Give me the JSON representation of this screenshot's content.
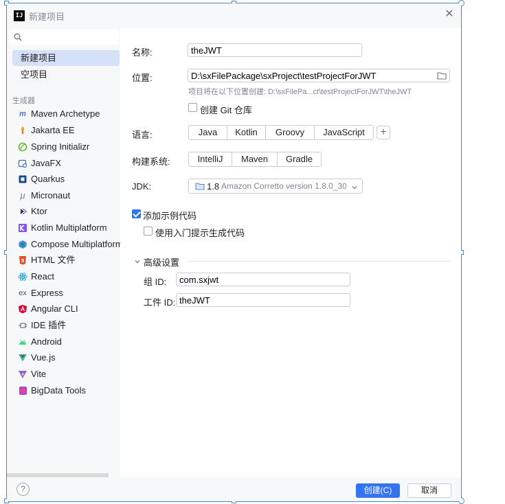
{
  "window": {
    "title": "新建项目",
    "close_icon": "close-icon"
  },
  "sidebar": {
    "search_placeholder": "",
    "top_items": [
      {
        "label": "新建项目",
        "selected": true
      },
      {
        "label": "空项目",
        "selected": false
      }
    ],
    "section_label": "生成器",
    "generators": [
      {
        "label": "Maven Archetype",
        "icon": "maven-icon"
      },
      {
        "label": "Jakarta EE",
        "icon": "jakarta-ee-icon"
      },
      {
        "label": "Spring Initializr",
        "icon": "spring-icon"
      },
      {
        "label": "JavaFX",
        "icon": "javafx-icon"
      },
      {
        "label": "Quarkus",
        "icon": "quarkus-icon"
      },
      {
        "label": "Micronaut",
        "icon": "micronaut-icon"
      },
      {
        "label": "Ktor",
        "icon": "ktor-icon"
      },
      {
        "label": "Kotlin Multiplatform",
        "icon": "kotlin-icon"
      },
      {
        "label": "Compose Multiplatform",
        "icon": "compose-icon"
      },
      {
        "label": "HTML 文件",
        "icon": "html5-icon"
      },
      {
        "label": "React",
        "icon": "react-icon"
      },
      {
        "label": "Express",
        "icon": "express-icon"
      },
      {
        "label": "Angular CLI",
        "icon": "angular-icon"
      },
      {
        "label": "IDE 插件",
        "icon": "plugin-icon"
      },
      {
        "label": "Android",
        "icon": "android-icon"
      },
      {
        "label": "Vue.js",
        "icon": "vue-icon"
      },
      {
        "label": "Vite",
        "icon": "vite-icon"
      },
      {
        "label": "BigData Tools",
        "icon": "bigdata-icon"
      }
    ]
  },
  "form": {
    "name_label": "名称:",
    "name_value": "theJWT",
    "location_label": "位置:",
    "location_value": "D:\\sxFilePackage\\sxProject\\testProjectForJWT",
    "location_hint": "项目将在以下位置创建: D:\\sxFilePa...ct\\testProjectForJWT\\theJWT",
    "git_label": "创建 Git 仓库",
    "git_checked": false,
    "language_label": "语言:",
    "languages": [
      "Java",
      "Kotlin",
      "Groovy",
      "JavaScript"
    ],
    "build_label": "构建系统:",
    "build_systems": [
      "IntelliJ",
      "Maven",
      "Gradle"
    ],
    "jdk_label": "JDK:",
    "jdk_version": "1.8",
    "jdk_name": "Amazon Corretto version 1.8.0_30",
    "sample_label": "添加示例代码",
    "sample_checked": true,
    "onboarding_label": "使用入门提示生成代码",
    "onboarding_checked": false,
    "advanced_label": "高级设置",
    "group_label": "组 ID:",
    "group_value": "com.sxjwt",
    "artifact_label": "工件 ID:",
    "artifact_value": "theJWT"
  },
  "footer": {
    "help": "?",
    "create": "创建(C)",
    "cancel": "取消"
  },
  "colors": {
    "accent": "#3574f0",
    "selection": "#d5e1f6",
    "panel": "#f7f8fa"
  }
}
